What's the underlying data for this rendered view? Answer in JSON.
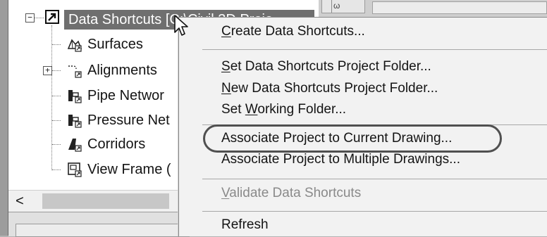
{
  "tree": {
    "root_label": "Data Shortcuts [C:\\Civil 3D Proje",
    "items": [
      {
        "label": "Surfaces",
        "icon": "surface-icon"
      },
      {
        "label": "Alignments",
        "icon": "alignment-icon"
      },
      {
        "label": "Pipe Networ",
        "icon": "pipe-network-icon"
      },
      {
        "label": "Pressure Net",
        "icon": "pressure-network-icon"
      },
      {
        "label": "Corridors",
        "icon": "corridor-icon"
      },
      {
        "label": "View Frame (",
        "icon": "view-frame-icon"
      }
    ],
    "scroll_left_glyph": "<"
  },
  "context_menu": {
    "items": [
      {
        "label": "Create Data Shortcuts...",
        "mnemonic": "C",
        "enabled": true
      },
      {
        "label": "Set Data Shortcuts Project Folder...",
        "mnemonic": "S",
        "enabled": true
      },
      {
        "label": "New Data Shortcuts Project Folder...",
        "mnemonic": "N",
        "enabled": true
      },
      {
        "label": "Set Working Folder...",
        "mnemonic": "W",
        "enabled": true
      },
      {
        "label": "Associate Project to Current Drawing...",
        "mnemonic": "",
        "enabled": true,
        "highlighted": true
      },
      {
        "label": "Associate Project to Multiple Drawings...",
        "mnemonic": "",
        "enabled": true
      },
      {
        "label": "Validate Data Shortcuts",
        "mnemonic": "V",
        "enabled": false
      },
      {
        "label": "Refresh",
        "mnemonic": "",
        "enabled": true
      }
    ]
  },
  "colors": {
    "selection": "#6f6f6f",
    "menu_background": "#f2f2f2",
    "disabled_text": "#8a8a8a",
    "highlight_ring": "#505050"
  }
}
